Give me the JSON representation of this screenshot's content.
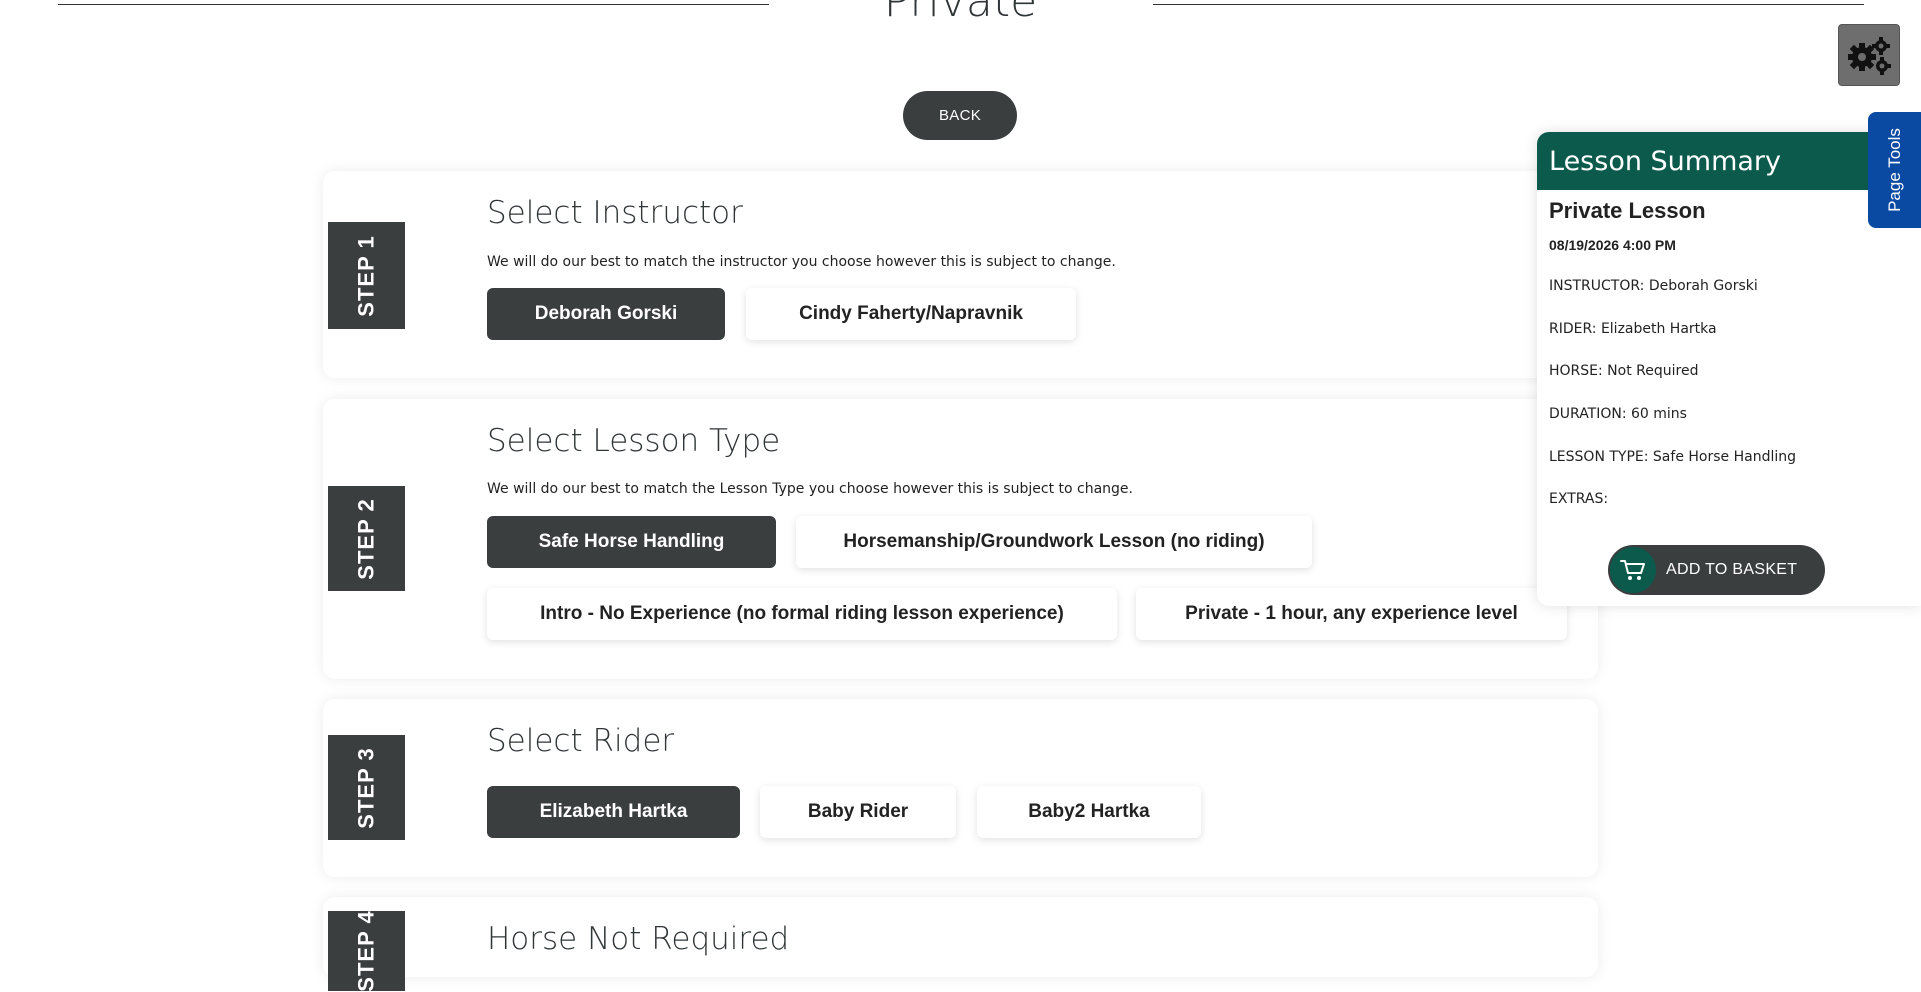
{
  "header": {
    "title": "Private",
    "back_label": "BACK"
  },
  "steps": [
    {
      "tab": "STEP 1",
      "title": "Select Instructor",
      "description": "We will do our best to match the instructor you choose however this is subject to change.",
      "options": [
        {
          "label": "Deborah Gorski",
          "selected": true
        },
        {
          "label": "Cindy Faherty/Napravnik",
          "selected": false
        }
      ]
    },
    {
      "tab": "STEP 2",
      "title": "Select Lesson Type",
      "description": "We will do our best to match the Lesson Type you choose however this is subject to change.",
      "options": [
        {
          "label": "Safe Horse Handling",
          "selected": true
        },
        {
          "label": "Horsemanship/Groundwork Lesson (no riding)",
          "selected": false
        },
        {
          "label": "Intro - No Experience (no formal riding lesson experience)",
          "selected": false
        },
        {
          "label": "Private - 1 hour, any experience level",
          "selected": false
        }
      ]
    },
    {
      "tab": "STEP 3",
      "title": "Select Rider",
      "options": [
        {
          "label": "Elizabeth Hartka",
          "selected": true
        },
        {
          "label": "Baby Rider",
          "selected": false
        },
        {
          "label": "Baby2 Hartka",
          "selected": false
        }
      ]
    },
    {
      "tab": "STEP 4",
      "title": "Horse Not Required"
    }
  ],
  "summary": {
    "heading": "Lesson Summary",
    "lesson": "Private Lesson",
    "datetime": "08/19/2026 4:00 PM",
    "instructor": "INSTRUCTOR: Deborah Gorski",
    "rider": "RIDER: Elizabeth Hartka",
    "horse": "HORSE: Not Required",
    "duration": "DURATION: 60 mins",
    "lesson_type": "LESSON TYPE: Safe Horse Handling",
    "extras": "EXTRAS:",
    "basket_label": "ADD TO BASKET"
  },
  "page_tools_label": "Page Tools",
  "icons": {
    "settings": "gears-icon",
    "cart": "cart-icon"
  },
  "colors": {
    "dark": "#3a3e3f",
    "summary_header": "#0b5a4c",
    "page_tools": "#0a4aa3"
  }
}
